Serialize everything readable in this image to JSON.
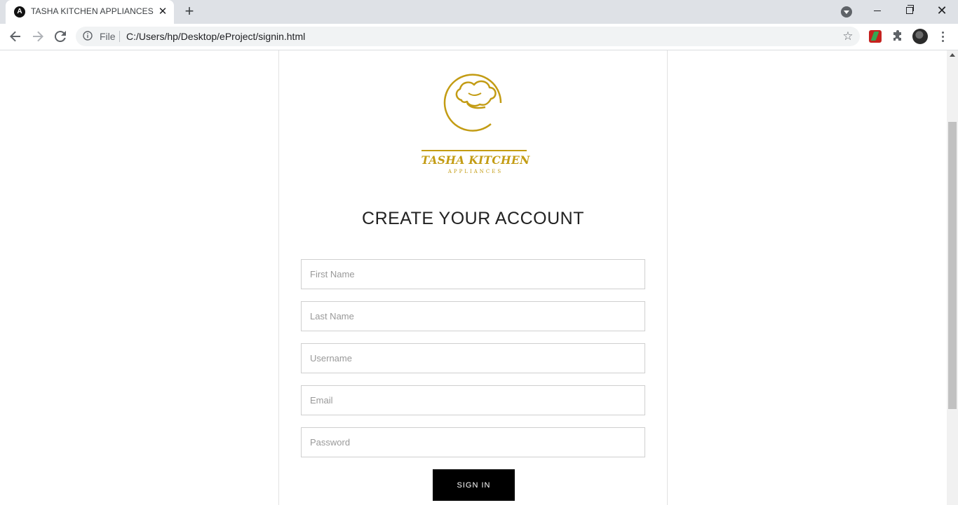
{
  "browser": {
    "tab": {
      "favicon_letter": "A",
      "title": "TASHA KITCHEN APPLIANCES"
    },
    "omnibox": {
      "scheme_label": "File",
      "url": "C:/Users/hp/Desktop/eProject/signin.html"
    }
  },
  "brand": {
    "name": "TASHA KITCHEN",
    "subtitle": "APPLIANCES",
    "color": "#c39c14"
  },
  "form": {
    "heading": "CREATE YOUR ACCOUNT",
    "fields": [
      {
        "placeholder": "First Name"
      },
      {
        "placeholder": "Last Name"
      },
      {
        "placeholder": "Username"
      },
      {
        "placeholder": "Email"
      },
      {
        "placeholder": "Password"
      }
    ],
    "submit_label": "SIGN IN"
  }
}
